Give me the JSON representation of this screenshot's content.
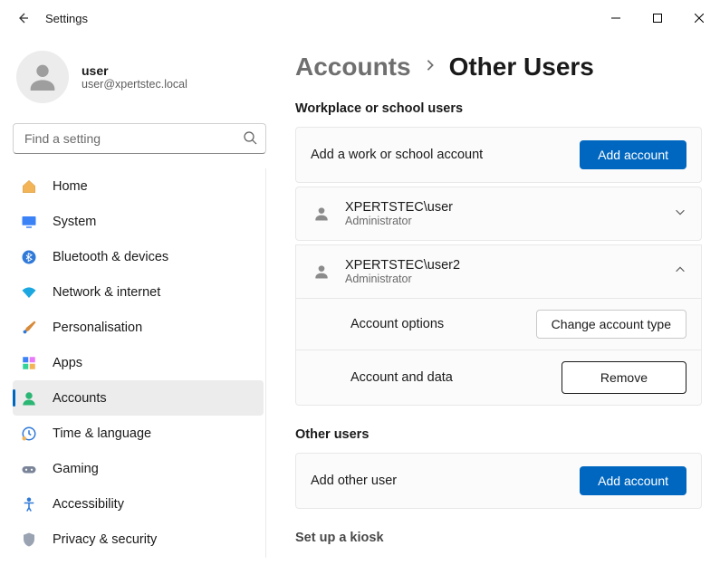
{
  "app": {
    "title": "Settings"
  },
  "profile": {
    "name": "user",
    "email": "user@xpertstec.local"
  },
  "search": {
    "placeholder": "Find a setting"
  },
  "nav": {
    "items": [
      {
        "label": "Home"
      },
      {
        "label": "System"
      },
      {
        "label": "Bluetooth & devices"
      },
      {
        "label": "Network & internet"
      },
      {
        "label": "Personalisation"
      },
      {
        "label": "Apps"
      },
      {
        "label": "Accounts"
      },
      {
        "label": "Time & language"
      },
      {
        "label": "Gaming"
      },
      {
        "label": "Accessibility"
      },
      {
        "label": "Privacy & security"
      }
    ]
  },
  "breadcrumb": {
    "root": "Accounts",
    "leaf": "Other Users"
  },
  "sections": {
    "workplace": {
      "title": "Workplace or school users",
      "add_label": "Add a work or school account",
      "add_button": "Add account",
      "users": [
        {
          "name": "XPERTSTEC\\user",
          "role": "Administrator"
        },
        {
          "name": "XPERTSTEC\\user2",
          "role": "Administrator"
        }
      ],
      "account_options": {
        "label": "Account options",
        "button": "Change account type"
      },
      "account_data": {
        "label": "Account and data",
        "button": "Remove"
      }
    },
    "other": {
      "title": "Other users",
      "add_label": "Add other user",
      "add_button": "Add account"
    },
    "kiosk": {
      "title": "Set up a kiosk"
    }
  }
}
